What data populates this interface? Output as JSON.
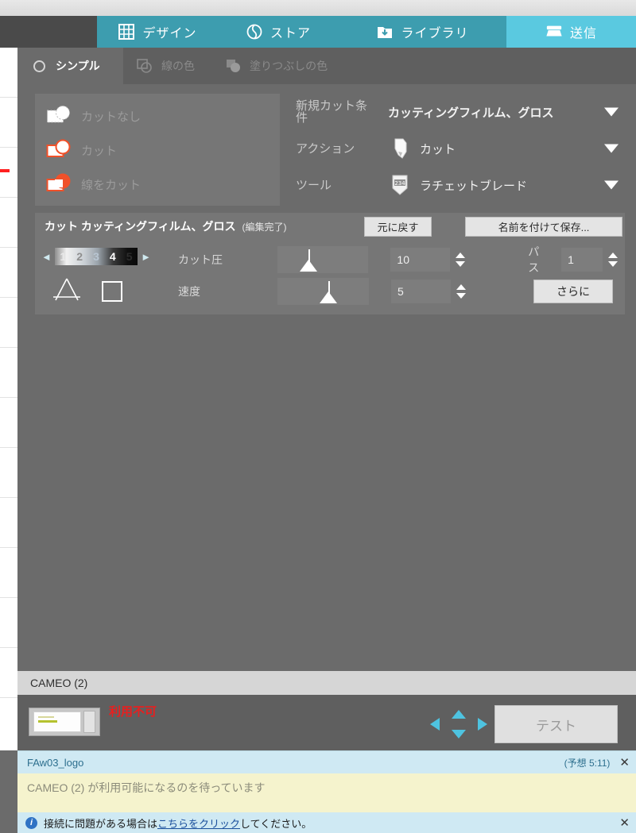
{
  "header": {
    "tabs": [
      {
        "label": "デザイン",
        "icon": "grid-icon",
        "active": false
      },
      {
        "label": "ストア",
        "icon": "store-icon",
        "active": false
      },
      {
        "label": "ライブラリ",
        "icon": "library-download-icon",
        "active": false
      },
      {
        "label": "送信",
        "icon": "cutter-icon",
        "active": true
      }
    ]
  },
  "option_tabs": [
    {
      "label": "シンプル",
      "icon": "circle-outline-icon",
      "active": true
    },
    {
      "label": "線の色",
      "icon": "line-color-icon",
      "active": false
    },
    {
      "label": "塗りつぶしの色",
      "icon": "fill-color-icon",
      "active": false
    }
  ],
  "cut_modes": [
    {
      "label": "カットなし",
      "icon": "no-cut-icon"
    },
    {
      "label": "カット",
      "icon": "cut-icon"
    },
    {
      "label": "線をカット",
      "icon": "cut-edge-icon"
    }
  ],
  "fields": [
    {
      "label": "新規カット条",
      "label_wrap": "件",
      "value": "カッティングフィルム、グロス",
      "icon": "",
      "caret": "chevron-down-icon"
    },
    {
      "label": "アクション",
      "label_wrap": "",
      "value": "カット",
      "icon": "blade-icon",
      "caret": "chevron-down-icon"
    },
    {
      "label": "ツール",
      "label_wrap": "",
      "value": "ラチェットブレード",
      "icon": "ratchet-blade-icon",
      "caret": "chevron-down-icon"
    }
  ],
  "card": {
    "title_bold": "カット カッティングフィルム、グロス",
    "title_note": "(編集完了)",
    "undo_label": "元に戻す",
    "saveas_label": "名前を付けて保存...",
    "depth_numbers": [
      "1",
      "2",
      "3",
      "4",
      "5"
    ],
    "depth_left_arrow": "◄",
    "depth_right_arrow": "►",
    "params": [
      {
        "label": "カット圧",
        "value": "10",
        "slider_pct": 34
      },
      {
        "label": "速度",
        "value": "5",
        "slider_pct": 56
      }
    ],
    "pass_label": "パス",
    "pass_value": "1",
    "more_label": "さらに"
  },
  "device": {
    "name": "CAMEO (2)",
    "status": "利用不可",
    "test_label": "テスト",
    "printer_icon": "cutter-device-icon",
    "dpad_icon": "dpad-arrows-icon"
  },
  "notification": {
    "job_name": "FAw03_logo",
    "eta": "(予想 5:11)",
    "close_label": "✕",
    "message": "CAMEO (2) が利用可能になるのを待っています"
  },
  "infobar": {
    "icon": "info-icon",
    "prefix": "接続に問題がある場合は",
    "link": "こちらをクリック",
    "suffix": "してください。",
    "close_label": "✕"
  },
  "colors": {
    "teal": "#3d9daf",
    "teal_active": "#5ac9e0",
    "panel_gray": "#6b6b6b",
    "card_gray": "#767676",
    "alert_red": "#e81f1f",
    "notif_yellow": "#f5f3cd",
    "notif_blue": "#cfe9f3"
  }
}
